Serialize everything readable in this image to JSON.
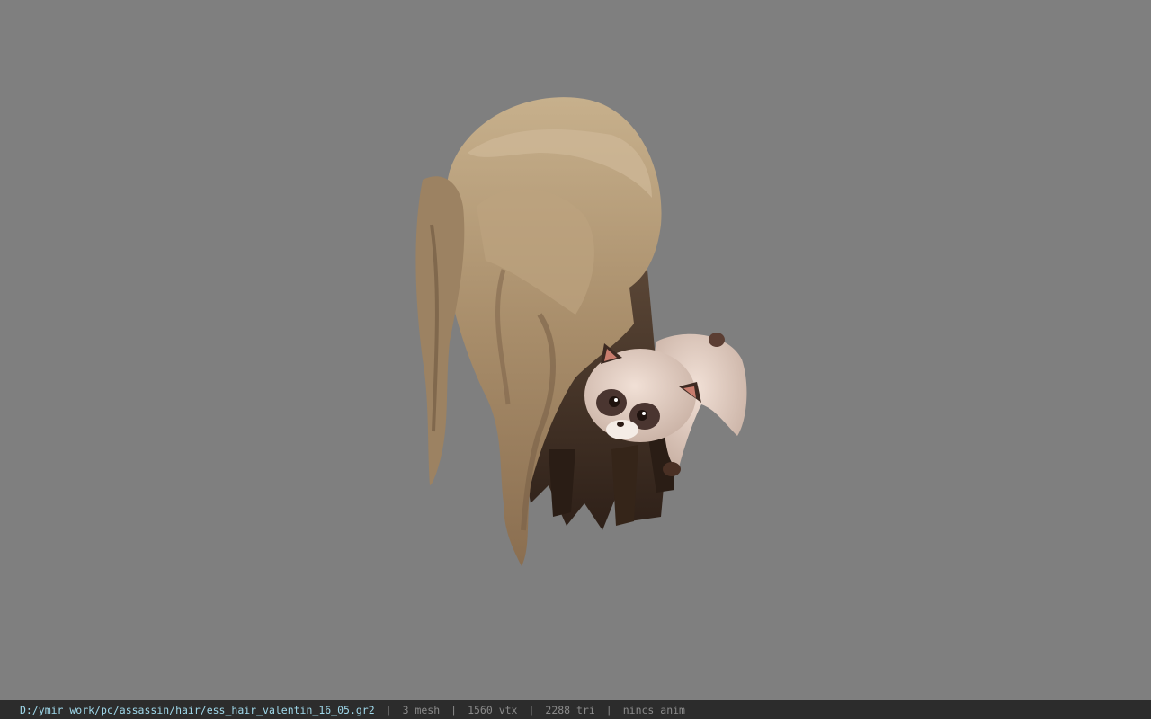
{
  "viewport": {
    "background_color": "#7f7f7f",
    "model": {
      "hair_colors": [
        "#b29a78",
        "#8c7356",
        "#3a2a1e"
      ],
      "plush_colors": [
        "#e2cdc2",
        "#4a3530",
        "#f0e6e0"
      ]
    }
  },
  "status_bar": {
    "file_path": "D:/ymir work/pc/assassin/hair/ess_hair_valentin_16_05.gr2",
    "separator": "|",
    "mesh_count": "3 mesh",
    "vertex_count": "1560 vtx",
    "triangle_count": "2288 tri",
    "anim_state": "nincs anim",
    "path_color": "#9fd8ea",
    "background_color": "#2c2c2c"
  }
}
